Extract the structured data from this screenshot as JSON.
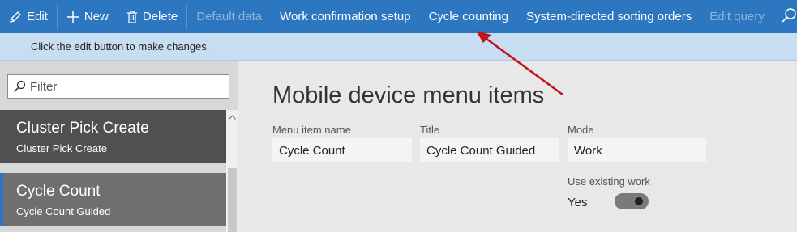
{
  "toolbar": {
    "edit": "Edit",
    "new": "New",
    "delete": "Delete",
    "default_data": "Default data",
    "work_confirmation": "Work confirmation setup",
    "cycle_counting": "Cycle counting",
    "sorting_orders": "System-directed sorting orders",
    "edit_query": "Edit query"
  },
  "message": "Click the edit button to make changes.",
  "filter": {
    "placeholder": "Filter"
  },
  "list": {
    "items": [
      {
        "title": "Cluster Pick Create",
        "subtitle": "Cluster Pick Create"
      },
      {
        "title": "Cycle Count",
        "subtitle": "Cycle Count Guided"
      }
    ]
  },
  "main": {
    "title": "Mobile device menu items",
    "fields": {
      "menu_item_name": {
        "label": "Menu item name",
        "value": "Cycle Count"
      },
      "title": {
        "label": "Title",
        "value": "Cycle Count Guided"
      },
      "mode": {
        "label": "Mode",
        "value": "Work"
      },
      "use_existing_work": {
        "label": "Use existing work",
        "value": "Yes",
        "on": true
      }
    }
  },
  "colors": {
    "toolbar": "#2d76c0",
    "message_bar": "#c7ddf1",
    "annotation_arrow": "#c0141a"
  }
}
